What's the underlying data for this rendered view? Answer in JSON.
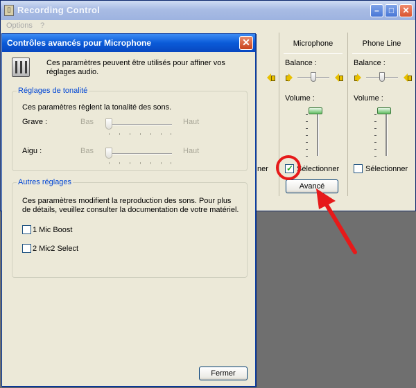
{
  "background_window": {
    "title": "Recording Control",
    "menu": "Options",
    "menu_suffix": "?",
    "partial_label": "ner",
    "channels": [
      {
        "name": "Microphone",
        "balance_label": "Balance :",
        "volume_label": "Volume :",
        "select_label": "Sélectionner",
        "selected": true,
        "advanced_label": "Avancé"
      },
      {
        "name": "Phone Line",
        "balance_label": "Balance :",
        "volume_label": "Volume :",
        "select_label": "Sélectionner",
        "selected": false
      }
    ]
  },
  "dialog": {
    "title": "Contrôles avancés pour Microphone",
    "description": "Ces paramètres peuvent être utilisés pour affiner vos réglages audio.",
    "tone_group": {
      "label": "Réglages de tonalité",
      "description": "Ces paramètres règlent la tonalité des sons.",
      "grave_label": "Grave :",
      "aigu_label": "Aigu :",
      "low_label": "Bas",
      "high_label": "Haut"
    },
    "other_group": {
      "label": "Autres réglages",
      "description": "Ces paramètres modifient la reproduction des sons. Pour plus de détails, veuillez consulter la documentation de votre matériel.",
      "options": [
        {
          "label": "1  Mic Boost",
          "checked": false
        },
        {
          "label": "2  Mic2 Select",
          "checked": false
        }
      ]
    },
    "close_button": "Fermer"
  },
  "colors": {
    "annotation": "#e61a1a",
    "group_label": "#0046d5",
    "titlebar": "#0a5bd8"
  },
  "icons": [
    "speaker-icon",
    "mixer-icon",
    "close-icon",
    "minimize-icon",
    "maximize-icon"
  ]
}
